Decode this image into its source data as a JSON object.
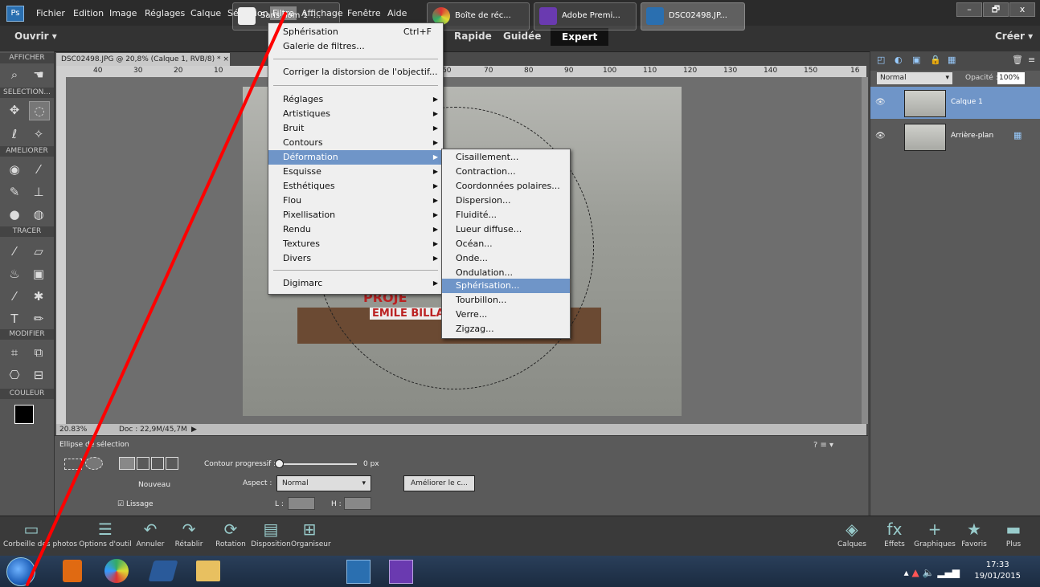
{
  "menubar": {
    "items": [
      "Fichier",
      "Edition",
      "Image",
      "Réglages",
      "Calque",
      "Sélection",
      "Filtre",
      "Affichage",
      "Fenêtre",
      "Aide"
    ],
    "active": "Filtre"
  },
  "window_controls": {
    "minimize": "–",
    "maximize": "🗗",
    "close": "x"
  },
  "modebar": {
    "open_label": "Ouvrir",
    "rapide": "Rapide",
    "guidee": "Guidée",
    "expert": "Expert",
    "create_label": "Créer"
  },
  "toolbox": {
    "sections": [
      "AFFICHER",
      "SELECTION...",
      "AMELIORER",
      "TRACER",
      "MODIFIER",
      "COULEUR"
    ]
  },
  "document": {
    "tab_label": "DSC02498.JPG @ 20,8% (Calque 1, RVB/8) *",
    "ruler_ticks": [
      "40",
      "30",
      "20",
      "10",
      "60",
      "70",
      "80",
      "90",
      "100",
      "110",
      "120",
      "130",
      "140",
      "150",
      "16"
    ],
    "zoom": "20.83%",
    "doc_size": "Doc : 22,9M/45,7M",
    "sign_line1": "PROJE",
    "sign_line2": "EMILE BILLA"
  },
  "filter_menu": {
    "top_item": "Sphérisation",
    "top_shortcut": "Ctrl+F",
    "gallery": "Galerie de filtres...",
    "correct": "Corriger la distorsion de l'objectif...",
    "categories": [
      "Réglages",
      "Artistiques",
      "Bruit",
      "Contours",
      "Déformation",
      "Esquisse",
      "Esthétiques",
      "Flou",
      "Pixellisation",
      "Rendu",
      "Textures",
      "Divers"
    ],
    "highlighted": "Déformation",
    "digimarc": "Digimarc"
  },
  "deformation_submenu": {
    "items": [
      "Cisaillement...",
      "Contraction...",
      "Coordonnées polaires...",
      "Dispersion...",
      "Fluidité...",
      "Lueur diffuse...",
      "Océan...",
      "Onde...",
      "Ondulation...",
      "Sphérisation...",
      "Tourbillon...",
      "Verre...",
      "Zigzag..."
    ],
    "highlighted": "Sphérisation..."
  },
  "layers_panel": {
    "blend_mode": "Normal",
    "opacity_label": "Opacité :",
    "opacity_value": "100%",
    "layers": [
      {
        "name": "Calque 1",
        "selected": true
      },
      {
        "name": "Arrière-plan",
        "selected": false
      }
    ]
  },
  "options_panel": {
    "title": "Ellipse de sélection",
    "nouveau": "Nouveau",
    "lissage": "Lissage",
    "contour_label": "Contour progressif :",
    "contour_value": "0 px",
    "aspect_label": "Aspect :",
    "aspect_value": "Normal",
    "l_label": "L :",
    "h_label": "H :",
    "ameliorer": "Améliorer le c..."
  },
  "actionbar": {
    "left": [
      "Corbeille des photos",
      "Options d'outil",
      "Annuler",
      "Rétablir",
      "Rotation",
      "Disposition",
      "Organiseur"
    ],
    "right": [
      "Calques",
      "Effets",
      "Graphiques",
      "Favoris",
      "Plus"
    ]
  },
  "taskbar": {
    "buttons": [
      {
        "label": "Sans nom 1 -..."
      },
      {
        "label": "Boîte de réc..."
      },
      {
        "label": "Adobe Premi..."
      },
      {
        "label": "DSC02498.JP..."
      }
    ],
    "time": "17:33",
    "date": "19/01/2015"
  },
  "colors": {
    "highlight": "#6f95c8",
    "annotation": "#ff0000",
    "menu_bg": "#efefef",
    "app_bg": "#4a4a4a"
  }
}
